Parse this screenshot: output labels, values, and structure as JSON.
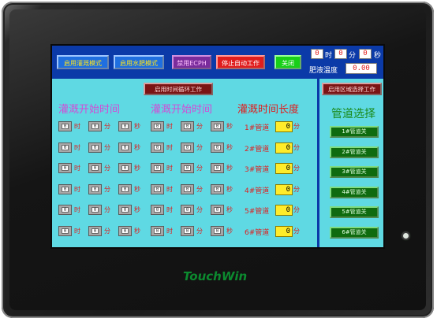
{
  "toolbar": {
    "btn_irrigation_mode": "启用灌溉模式",
    "btn_fert_mode": "启用水肥模式",
    "btn_disable_ecph": "禁用ECPH",
    "btn_stop_auto": "停止自动工作",
    "btn_close": "关闭"
  },
  "clock": {
    "hour": "0",
    "hour_unit": "时",
    "minute": "0",
    "minute_unit": "分",
    "second": "0",
    "second_unit": "秒"
  },
  "fert_temp": {
    "label": "肥液温度",
    "value": "0.00"
  },
  "cycle_button": "启用时间循环工作",
  "zone_button": "启用区域选择工作",
  "headers": {
    "start1": "灌溉开始时间",
    "start2": "灌溉开始时间",
    "duration": "灌溉时间长度",
    "pipe_select": "管道选择"
  },
  "time_units": {
    "h": "时",
    "m": "分",
    "s": "秒"
  },
  "cell_value": "0",
  "rows": [
    {
      "pipe": "1#管道",
      "duration": "0",
      "unit": "分",
      "select": "1#管道关"
    },
    {
      "pipe": "2#管道",
      "duration": "0",
      "unit": "分",
      "select": "2#管道关"
    },
    {
      "pipe": "3#管道",
      "duration": "0",
      "unit": "分",
      "select": "3#管道关"
    },
    {
      "pipe": "4#管道",
      "duration": "0",
      "unit": "分",
      "select": "4#管道关"
    },
    {
      "pipe": "5#管道",
      "duration": "0",
      "unit": "分",
      "select": "5#管道关"
    },
    {
      "pipe": "6#管道",
      "duration": "0",
      "unit": "分",
      "select": "6#管道关"
    }
  ],
  "brand": {
    "logo": "TouchWin"
  }
}
